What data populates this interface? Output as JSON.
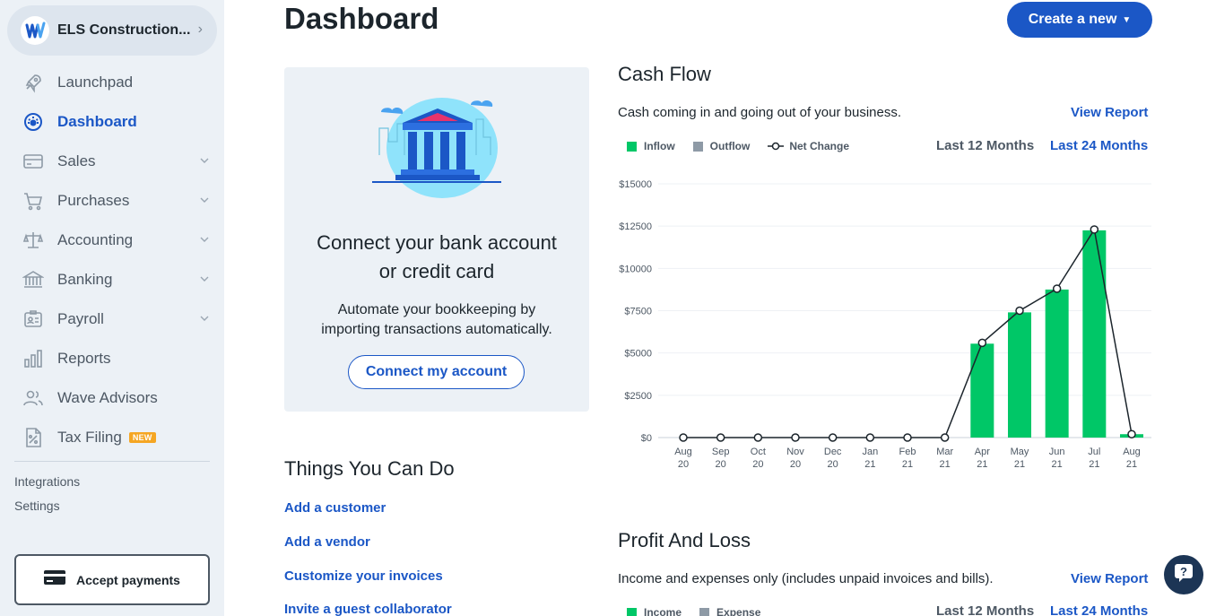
{
  "sidebar": {
    "business_name": "ELS Construction...",
    "items": [
      {
        "label": "Launchpad",
        "icon": "rocket-icon"
      },
      {
        "label": "Dashboard",
        "icon": "dashboard-icon"
      },
      {
        "label": "Sales",
        "icon": "card-icon"
      },
      {
        "label": "Purchases",
        "icon": "cart-icon"
      },
      {
        "label": "Accounting",
        "icon": "scale-icon"
      },
      {
        "label": "Banking",
        "icon": "bank-icon"
      },
      {
        "label": "Payroll",
        "icon": "id-badge-icon"
      },
      {
        "label": "Reports",
        "icon": "bar-chart-icon"
      },
      {
        "label": "Wave Advisors",
        "icon": "people-icon"
      },
      {
        "label": "Tax Filing",
        "icon": "tax-document-icon",
        "badge": "NEW"
      }
    ],
    "active_item": "Dashboard",
    "integrations_label": "Integrations",
    "settings_label": "Settings",
    "accept_payments_label": "Accept payments"
  },
  "header": {
    "title": "Dashboard",
    "create_button": "Create a new"
  },
  "bank_card": {
    "title_line1": "Connect your bank account",
    "title_line2": "or credit card",
    "desc_line1": "Automate your bookkeeping by",
    "desc_line2": "importing transactions automatically.",
    "button": "Connect my account"
  },
  "things": {
    "title": "Things You Can Do",
    "links": [
      "Add a customer",
      "Add a vendor",
      "Customize your invoices",
      "Invite a guest collaborator"
    ]
  },
  "cash_flow": {
    "title": "Cash Flow",
    "description": "Cash coming in and going out of your business.",
    "view_report": "View Report",
    "legend": {
      "inflow": "Inflow",
      "outflow": "Outflow",
      "net_change": "Net Change"
    },
    "range_12": "Last 12 Months",
    "range_24": "Last 24 Months"
  },
  "profit_loss": {
    "title": "Profit And Loss",
    "description": "Income and expenses only (includes unpaid invoices and bills).",
    "view_report": "View Report",
    "legend": {
      "income": "Income",
      "expense": "Expense"
    },
    "range_12": "Last 12 Months",
    "range_24": "Last 24 Months"
  },
  "colors": {
    "accent": "#1b57c6",
    "inflow": "#00c767",
    "outflow": "#8e9aa6",
    "sidebar_bg": "#ecf1f6"
  },
  "chart_data": {
    "type": "bar",
    "categories": [
      [
        "Aug",
        "20"
      ],
      [
        "Sep",
        "20"
      ],
      [
        "Oct",
        "20"
      ],
      [
        "Nov",
        "20"
      ],
      [
        "Dec",
        "20"
      ],
      [
        "Jan",
        "21"
      ],
      [
        "Feb",
        "21"
      ],
      [
        "Mar",
        "21"
      ],
      [
        "Apr",
        "21"
      ],
      [
        "May",
        "21"
      ],
      [
        "Jun",
        "21"
      ],
      [
        "Jul",
        "21"
      ],
      [
        "Aug",
        "21"
      ]
    ],
    "series": [
      {
        "name": "Inflow",
        "values": [
          0,
          0,
          0,
          0,
          0,
          0,
          0,
          0,
          5550,
          7400,
          8750,
          12250,
          200
        ]
      },
      {
        "name": "Outflow",
        "values": [
          0,
          0,
          0,
          0,
          0,
          0,
          0,
          0,
          0,
          0,
          0,
          0,
          0
        ]
      },
      {
        "name": "Net Change",
        "values": [
          0,
          0,
          0,
          0,
          0,
          0,
          0,
          0,
          5600,
          7500,
          8800,
          12300,
          200
        ]
      }
    ],
    "yticks": [
      "$0",
      "$2500",
      "$5000",
      "$7500",
      "$10000",
      "$12500",
      "$15000"
    ],
    "ylim": [
      0,
      15000
    ],
    "grid": true,
    "legend": "top-left"
  }
}
